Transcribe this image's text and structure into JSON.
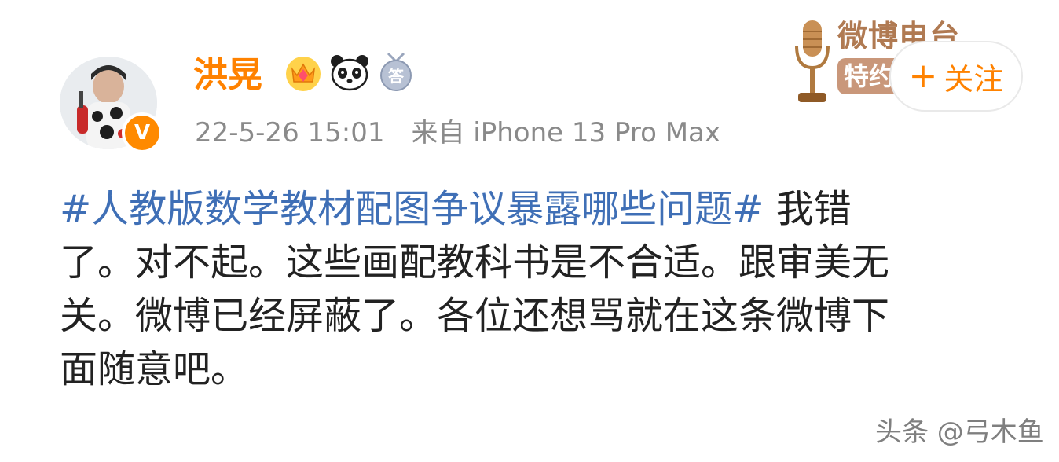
{
  "user": {
    "name": "洪晃",
    "verified_mark": "V",
    "badges": [
      "crown-badge-icon",
      "panda-badge-icon",
      "answer-badge-icon"
    ],
    "badge_text": "答"
  },
  "meta": {
    "time": "22-5-26 15:01",
    "source": "来自 iPhone 13 Pro Max"
  },
  "radio_badge": {
    "title": "微博电台",
    "tag": "特约"
  },
  "follow": {
    "label": "关注",
    "plus": "+"
  },
  "post": {
    "hashtag": "#人教版数学教材配图争议暴露哪些问题#",
    "line1_rest": " 我错",
    "line2": "了。对不起。这些画配教科书是不合适。跟审美无",
    "line3": "关。微博已经屏蔽了。各位还想骂就在这条微博下",
    "line4": "面随意吧。"
  },
  "watermark": "头条 @弓木鱼",
  "colors": {
    "username": "#ff8200",
    "hashtag": "#3f6fb6",
    "meta": "#8a8a8a",
    "text": "#222222",
    "verified": "#ff8a00"
  }
}
